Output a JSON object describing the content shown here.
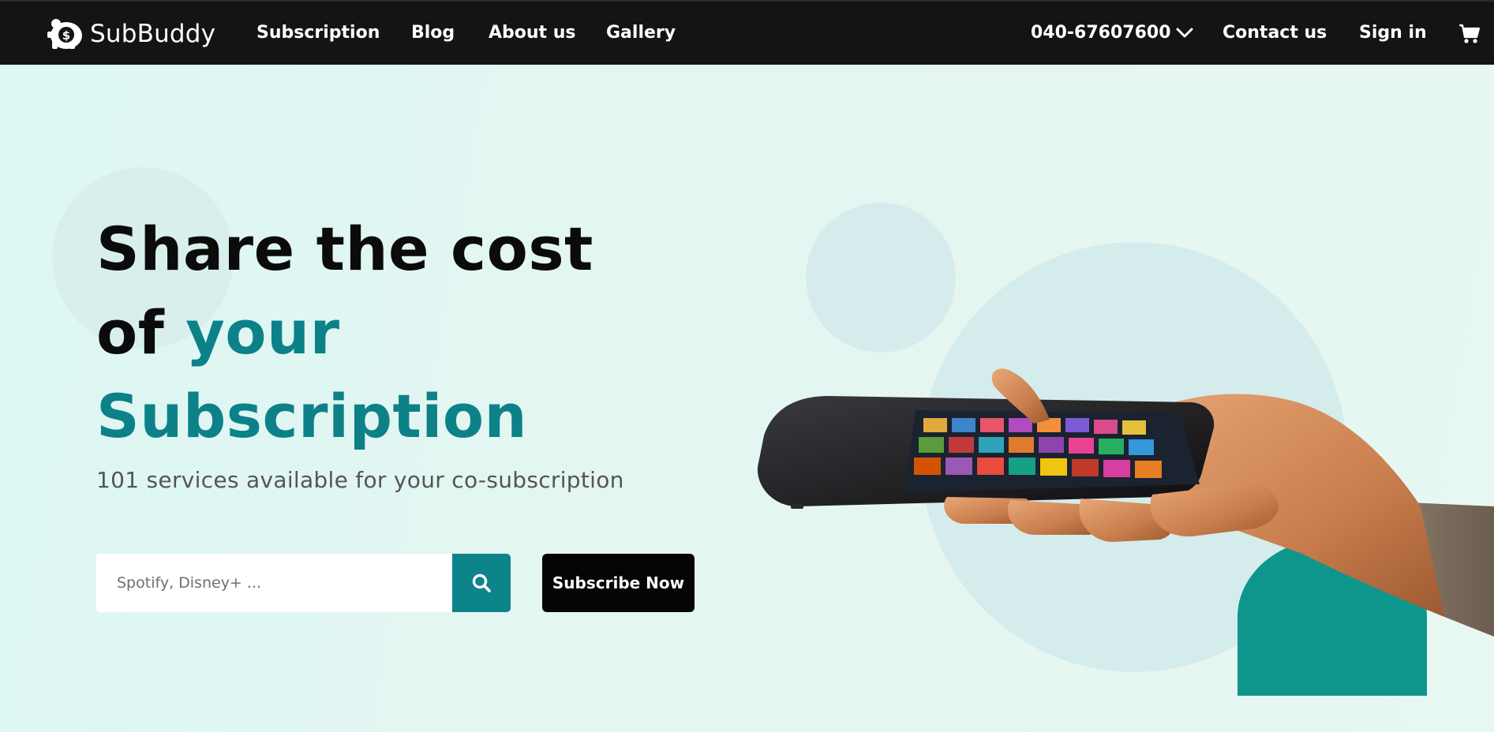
{
  "brand": {
    "name": "SubBuddy",
    "logo_icon": "piggy-bank-dollar-icon"
  },
  "nav": {
    "links": [
      "Subscription",
      "Blog",
      "About us",
      "Gallery"
    ],
    "phone": "040-67607600",
    "phone_icon": "chevron-down-icon",
    "contact": "Contact us",
    "signin": "Sign in",
    "cart_icon": "cart-icon"
  },
  "hero": {
    "headline_line1": "Share the cost",
    "headline_of": "of",
    "headline_your": "your",
    "headline_line3": "Subscription",
    "subtext": "101 services available for your co-subscription",
    "search_placeholder": "Spotify, Disney+ ...",
    "search_icon": "search-icon",
    "cta": "Subscribe Now",
    "image": "hand-holding-smartphone-with-app-icons"
  },
  "colors": {
    "nav_bg": "#141414",
    "hero_bg": "#e3f7f3",
    "accent_teal": "#0c8188",
    "cta_bg": "#050505"
  }
}
